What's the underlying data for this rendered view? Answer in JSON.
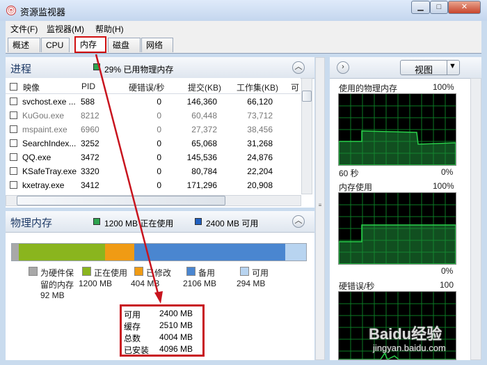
{
  "window": {
    "title": "资源监视器",
    "icon_name": "resource-monitor-icon",
    "min": "▁",
    "max": "□",
    "close": "✕"
  },
  "menu": [
    {
      "label": "文件(F)"
    },
    {
      "label": "监视器(M)"
    },
    {
      "label": "帮助(H)"
    }
  ],
  "tabs": [
    {
      "label": "概述"
    },
    {
      "label": "CPU"
    },
    {
      "label": "内存",
      "active": true
    },
    {
      "label": "磁盘"
    },
    {
      "label": "网络"
    }
  ],
  "process_panel": {
    "title": "进程",
    "summary": "29% 已用物理内存",
    "columns": [
      "映像",
      "PID",
      "硬错误/秒",
      "提交(KB)",
      "工作集(KB)",
      "可"
    ],
    "rows": [
      {
        "name": "svchost.exe ...",
        "pid": "588",
        "hard": "0",
        "commit": "146,360",
        "ws": "66,120",
        "grey": false
      },
      {
        "name": "KuGou.exe",
        "pid": "8212",
        "hard": "0",
        "commit": "60,448",
        "ws": "73,712",
        "grey": true
      },
      {
        "name": "mspaint.exe",
        "pid": "6960",
        "hard": "0",
        "commit": "27,372",
        "ws": "38,456",
        "grey": true
      },
      {
        "name": "SearchIndex...",
        "pid": "3252",
        "hard": "0",
        "commit": "65,068",
        "ws": "31,268",
        "grey": false
      },
      {
        "name": "QQ.exe",
        "pid": "3472",
        "hard": "0",
        "commit": "145,536",
        "ws": "24,876",
        "grey": false
      },
      {
        "name": "KSafeTray.exe",
        "pid": "3320",
        "hard": "0",
        "commit": "80,784",
        "ws": "22,204",
        "grey": false
      },
      {
        "name": "kxetray.exe",
        "pid": "3412",
        "hard": "0",
        "commit": "171,296",
        "ws": "20,908",
        "grey": false
      }
    ]
  },
  "memory_panel": {
    "title": "物理内存",
    "in_use": "1200 MB 正在使用",
    "available": "2400 MB 可用",
    "bar": [
      {
        "label": "为硬件保留的内存",
        "mb": 92,
        "color": "#a8a8a8"
      },
      {
        "label": "正在使用",
        "mb": 1200,
        "color": "#8ab51e"
      },
      {
        "label": "已修改",
        "mb": 404,
        "color": "#f09b14"
      },
      {
        "label": "备用",
        "mb": 2106,
        "color": "#4a86d0"
      },
      {
        "label": "可用",
        "mb": 294,
        "color": "#b8d4f0"
      }
    ],
    "legend": [
      {
        "line1": "为硬件保",
        "line2": "留的内存",
        "line3": "92 MB"
      },
      {
        "line1": "正在使用",
        "line2": "1200 MB"
      },
      {
        "line1": "已修改",
        "line2": "404 MB"
      },
      {
        "line1": "备用",
        "line2": "2106 MB"
      },
      {
        "line1": "可用",
        "line2": "294 MB"
      }
    ],
    "totals": [
      {
        "label": "可用",
        "value": "2400 MB"
      },
      {
        "label": "缓存",
        "value": "2510 MB"
      },
      {
        "label": "总数",
        "value": "4004 MB"
      },
      {
        "label": "已安装",
        "value": "4096 MB"
      }
    ]
  },
  "right_panel": {
    "expand_icon": "chevron-right-icon",
    "view_label": "视图",
    "graphs": [
      {
        "title": "使用的物理内存",
        "max": "100%",
        "time": "60 秒",
        "min": "0%"
      },
      {
        "title": "内存使用",
        "max": "100%",
        "min": "0%"
      },
      {
        "title": "硬错误/秒",
        "max": "100"
      }
    ]
  },
  "watermark": {
    "brand": "Baidu经验",
    "url": "jingyan.baidu.com"
  },
  "colors": {
    "annotation_red": "#c8141e",
    "graph_green": "#29d04a",
    "graph_grid": "#0b7a25"
  }
}
